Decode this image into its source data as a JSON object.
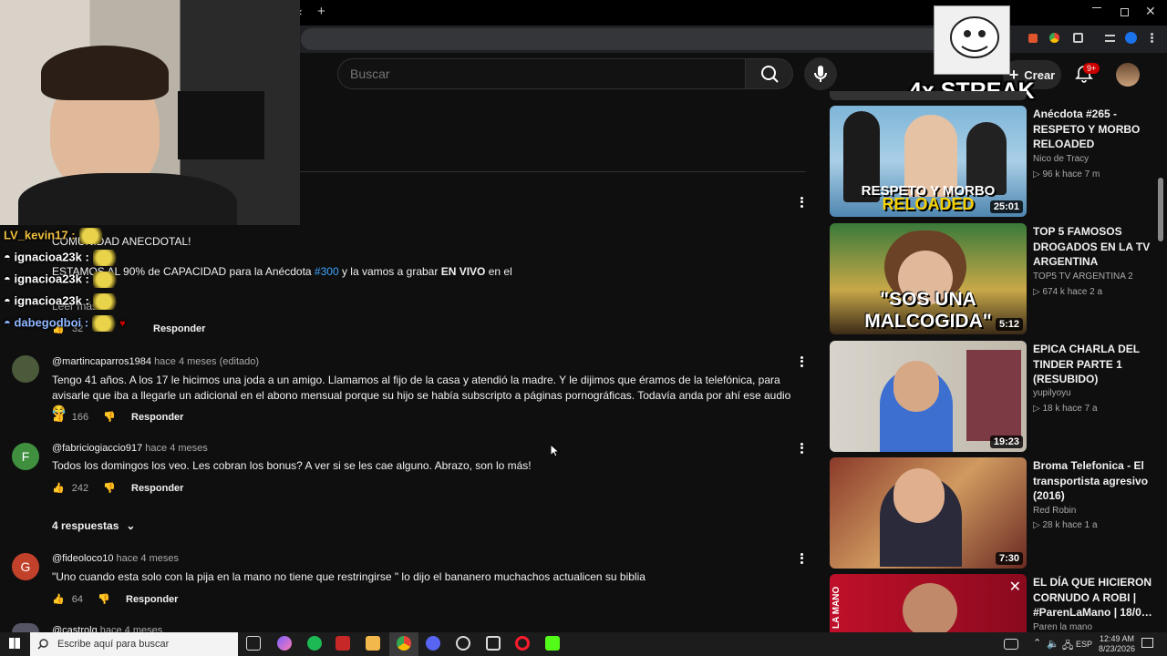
{
  "browser": {
    "new_tab_symbol": "+",
    "close_symbol": "×"
  },
  "search": {
    "placeholder": "Buscar"
  },
  "header": {
    "create_label": "Crear",
    "notif_count": "9+"
  },
  "overlay": {
    "streak_text": "4x STREAK"
  },
  "chat": [
    {
      "user": "LV_kevin17 :",
      "color": "#f0c040"
    },
    {
      "user": "ignacioa23k :",
      "color": "#ffffff"
    },
    {
      "user": "ignacioa23k :",
      "color": "#ffffff"
    },
    {
      "user": "ignacioa23k :",
      "color": "#ffffff"
    },
    {
      "user": "dabegodboi :",
      "color": "#8fb8ff"
    }
  ],
  "comments": {
    "c0": {
      "line1": "COMUNIDAD ANECDOTAL!",
      "line2a": "ESTAMOS AL 90% de CAPACIDAD para la  Anécdota ",
      "hashtag": "#300",
      "line2b": " y la vamos a grabar ",
      "line2c": "EN VIVO",
      "line2d": " en el",
      "read_more": "Leer más",
      "likes": "32",
      "reply": "Responder"
    },
    "c1": {
      "handle": "@martincaparros1984",
      "time": "hace 4 meses (editado)",
      "text": "Tengo 41 años. A los 17 le hicimos una joda a un amigo. Llamamos al fijo de la casa y atendió la madre. Y  le dijimos que éramos de la telefónica, para avisarle que iba a llegarle un adicional en el abono mensual porque su hijo se había subscripto a páginas pornográficas. Todavía anda por ahí ese audio 😂",
      "likes": "166",
      "reply": "Responder"
    },
    "c2": {
      "avatar_letter": "F",
      "handle": "@fabriciogiaccio917",
      "time": "hace 4 meses",
      "text": "Todos los domingos los veo. Les cobran los bonus? A ver si se les cae alguno. Abrazo, son lo más!",
      "likes": "242",
      "reply": "Responder",
      "replies": "4 respuestas"
    },
    "c3": {
      "avatar_letter": "G",
      "handle": "@fideoloco10",
      "time": "hace 4 meses",
      "text": "\"Uno cuando esta solo con la pija en la mano no tiene que restringirse \" lo dijo el bananero muchachos actualicen su biblia",
      "likes": "64",
      "reply": "Responder"
    },
    "c4": {
      "handle": "@castrolg",
      "time": "hace 4 meses"
    }
  },
  "videos": [
    {
      "title": "Anécdota #265  - RESPETO Y MORBO RELOADED",
      "channel": "Nico de Tracy",
      "meta": "▷ 96 k  hace 7 m",
      "duration": "25:01",
      "thumb_text": "RESPETO Y MORBO",
      "thumb_text2": "RELOADED",
      "bg": "#6aa0c8"
    },
    {
      "title": "TOP 5 FAMOSOS DROGADOS EN LA TV ARGENTINA",
      "channel": "TOP5 TV ARGENTINA 2",
      "meta": "▷ 674 k  hace 2 a",
      "duration": "5:12",
      "thumb_text": "\"SOS UNA MALCOGIDA\"",
      "bg": "#3a7a3a"
    },
    {
      "title": "EPICA CHARLA DEL TINDER  PARTE 1 (RESUBIDO)",
      "channel": "yupilyoyu",
      "meta": "▷ 18 k  hace 7 a",
      "duration": "19:23",
      "bg": "#c9c4b8"
    },
    {
      "title": "Broma Telefonica - El transportista agresivo (2016)",
      "channel": "Red Robin",
      "meta": "▷ 28 k  hace 1 a",
      "duration": "7:30",
      "bg": "#8a3a2a"
    },
    {
      "title": "EL DÍA QUE HICIERON CORNUDO A ROBI | #ParenLaMano | 18/0…",
      "channel": "Paren la mano",
      "meta": "",
      "thumb_text": "LA MANO",
      "bg": "#b0102a"
    }
  ],
  "taskbar": {
    "search_placeholder": "Escribe aquí para buscar",
    "time": "12:49 AM",
    "date": "8/23/2026",
    "lang": "ESP"
  }
}
